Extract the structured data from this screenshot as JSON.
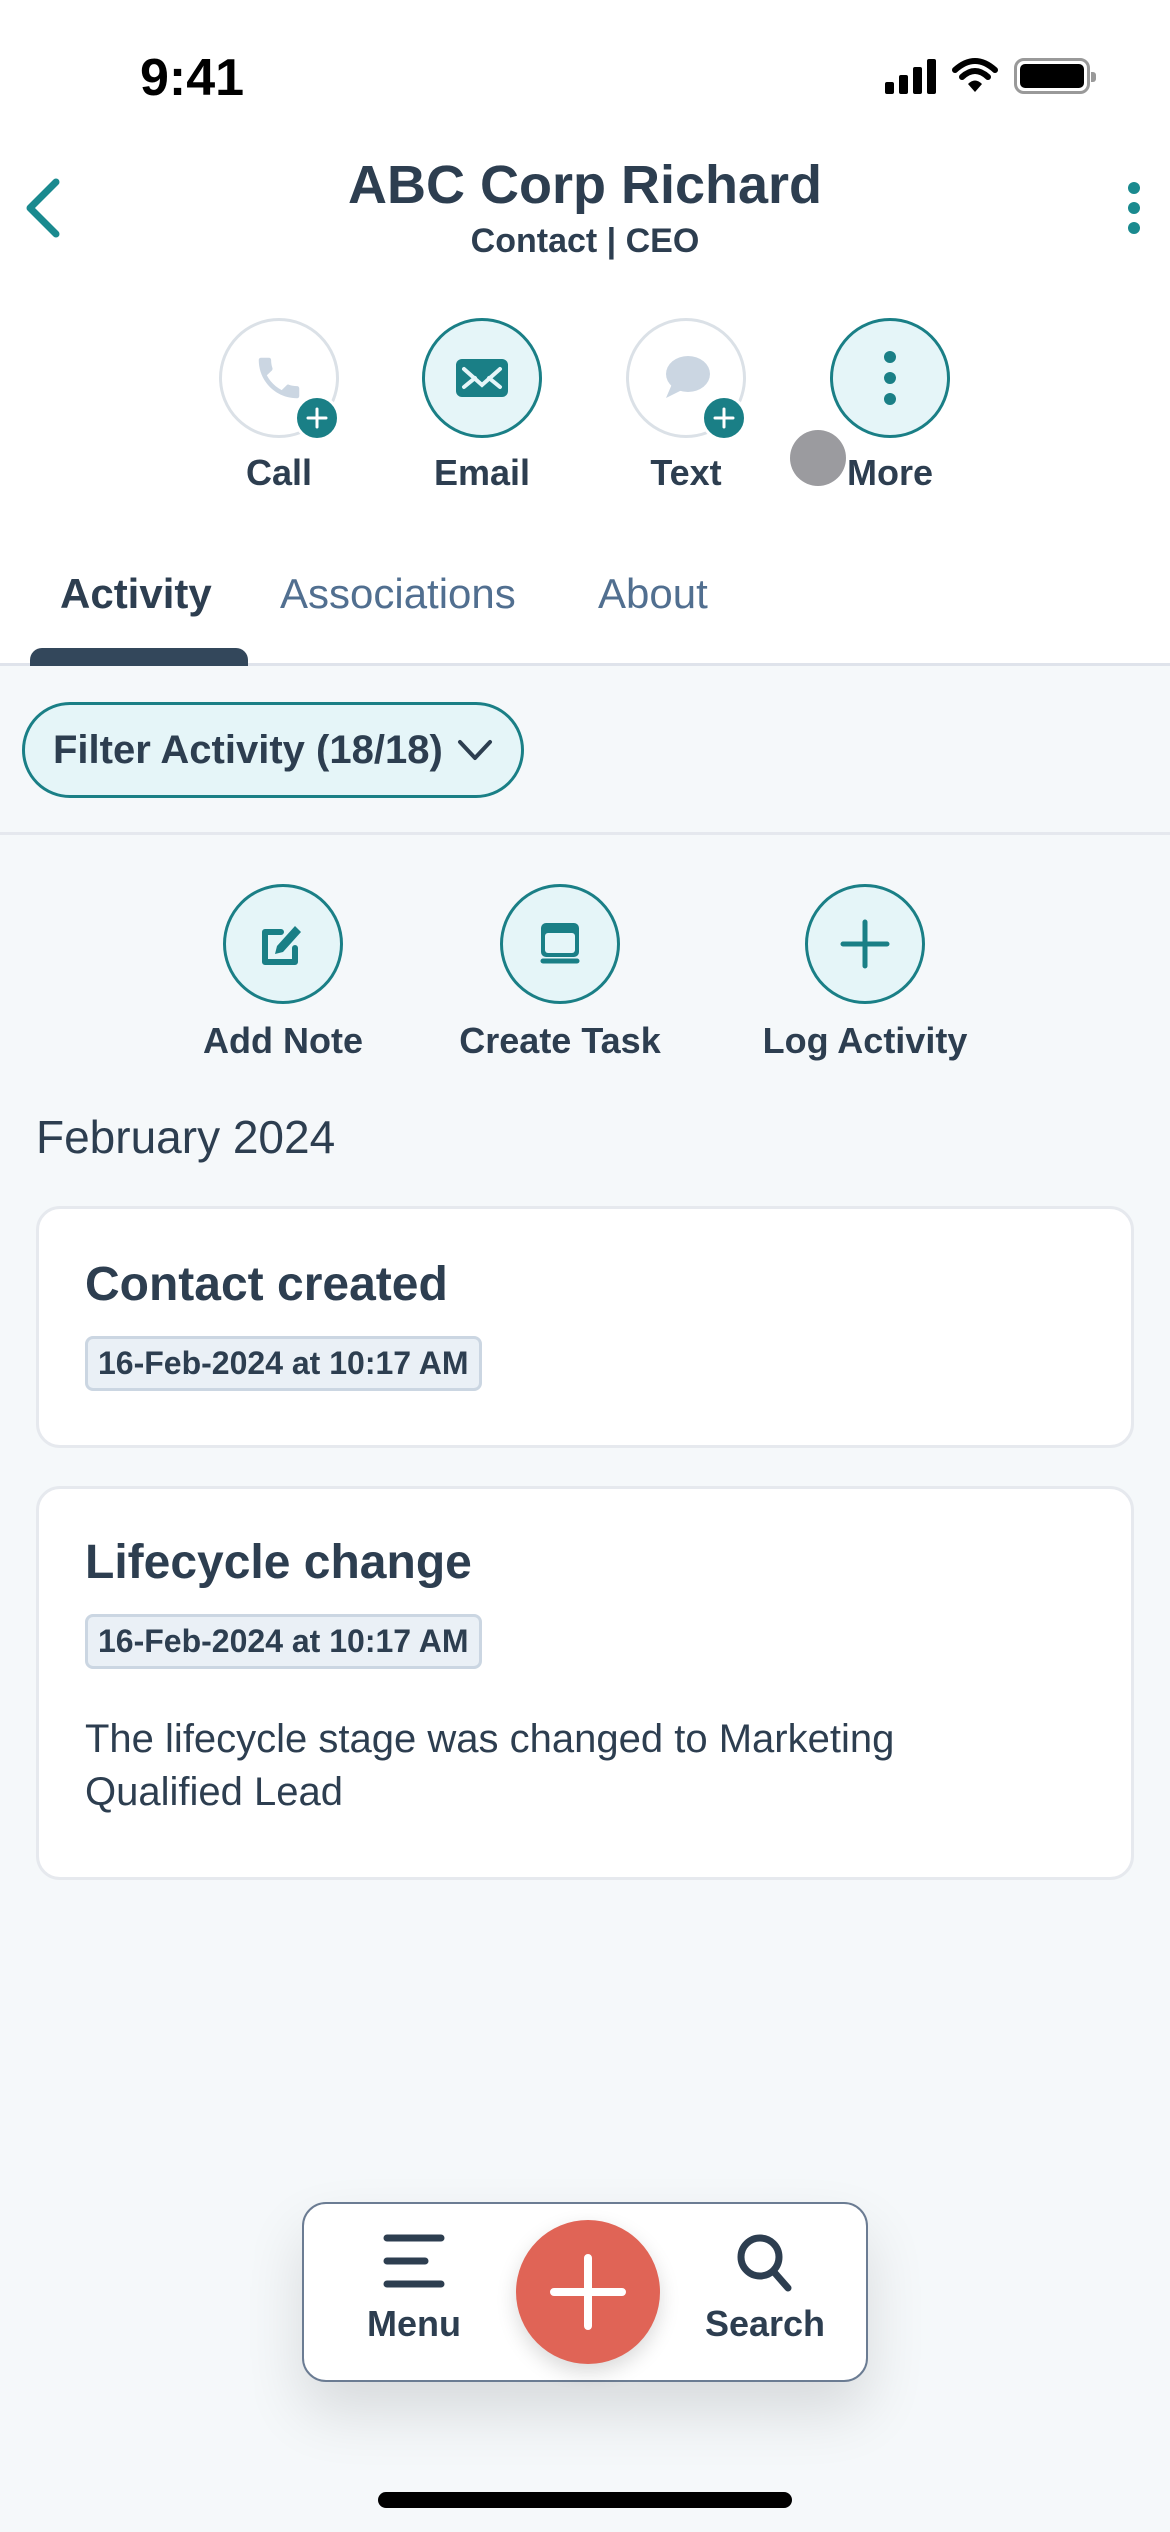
{
  "status_bar": {
    "time": "9:41"
  },
  "header": {
    "title": "ABC Corp Richard",
    "subtitle": "Contact | CEO"
  },
  "actions": [
    {
      "label": "Call",
      "icon": "phone-icon",
      "enabled": false
    },
    {
      "label": "Email",
      "icon": "email-icon",
      "enabled": true
    },
    {
      "label": "Text",
      "icon": "chat-bubble-icon",
      "enabled": false
    },
    {
      "label": "More",
      "icon": "more-vertical-icon",
      "enabled": true
    }
  ],
  "tabs": [
    {
      "label": "Activity",
      "active": true
    },
    {
      "label": "Associations",
      "active": false
    },
    {
      "label": "About",
      "active": false
    }
  ],
  "filter": {
    "label": "Filter Activity (18/18)"
  },
  "quick_actions": [
    {
      "label": "Add Note",
      "icon": "edit-note-icon"
    },
    {
      "label": "Create Task",
      "icon": "task-icon"
    },
    {
      "label": "Log Activity",
      "icon": "plus-icon"
    }
  ],
  "timeline": {
    "month": "February 2024",
    "items": [
      {
        "title": "Contact created",
        "timestamp": "16-Feb-2024 at 10:17 AM"
      },
      {
        "title": "Lifecycle change",
        "timestamp": "16-Feb-2024 at 10:17 AM",
        "body": "The lifecycle stage was changed to Marketing Qualified Lead"
      }
    ]
  },
  "bottom_nav": {
    "menu_label": "Menu",
    "search_label": "Search"
  },
  "colors": {
    "accent": "#1a7f86",
    "accent_bg": "#e5f5f8",
    "fab": "#e06456",
    "text": "#2d3e50"
  }
}
